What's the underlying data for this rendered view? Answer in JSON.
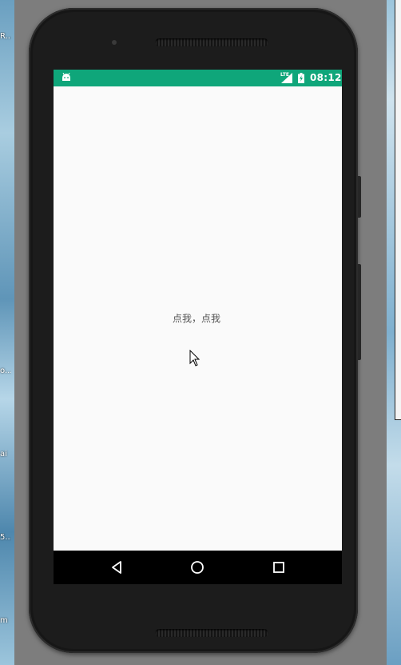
{
  "desktop": {
    "left_labels": [
      "R...",
      "o...",
      "ai",
      "5...",
      "m"
    ]
  },
  "status_bar": {
    "network_type": "LTE",
    "time": "08:12",
    "background_color": "#0fa67a"
  },
  "app": {
    "center_text": "点我，点我"
  },
  "nav_bar": {
    "icons": [
      "back-icon",
      "home-icon",
      "recents-icon"
    ]
  }
}
